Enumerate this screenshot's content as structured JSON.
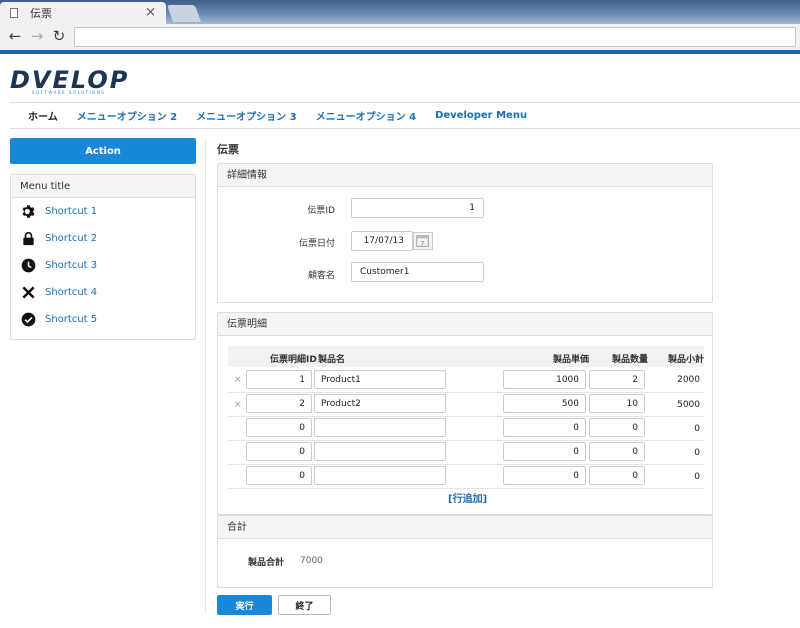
{
  "browser": {
    "tab_title": "伝票",
    "tab_close": "×",
    "nav_back": "←",
    "nav_forward": "→",
    "nav_reload": "↻"
  },
  "brand": {
    "logo_text": "DVELOP",
    "logo_sub": "SOFTWARE SOLUTIONS"
  },
  "nav": {
    "items": [
      "ホーム",
      "メニューオプション 2",
      "メニューオプション 3",
      "メニューオプション 4",
      "Developer Menu"
    ]
  },
  "sidebar": {
    "action_label": "Action",
    "menu_title": "Menu title",
    "shortcuts": [
      {
        "label": "Shortcut 1",
        "icon": "gear-icon"
      },
      {
        "label": "Shortcut 2",
        "icon": "lock-icon"
      },
      {
        "label": "Shortcut 3",
        "icon": "clock-icon"
      },
      {
        "label": "Shortcut 4",
        "icon": "close-icon"
      },
      {
        "label": "Shortcut 5",
        "icon": "check-circle-icon"
      }
    ]
  },
  "main": {
    "page_title": "伝票",
    "detail": {
      "heading": "詳細情報",
      "id_label": "伝票ID",
      "id_value": "1",
      "date_label": "伝票日付",
      "date_value": "17/07/13",
      "customer_label": "顧客名",
      "customer_value": "Customer1"
    },
    "lines": {
      "heading": "伝票明細",
      "columns": {
        "line_id": "伝票明細ID",
        "product": "製品名",
        "unit_price": "製品単価",
        "qty": "製品数量",
        "subtotal": "製品小計"
      },
      "delete_mark": "×",
      "rows": [
        {
          "line_id": "1",
          "product": "Product1",
          "unit_price": "1000",
          "qty": "2",
          "subtotal": "2000"
        },
        {
          "line_id": "2",
          "product": "Product2",
          "unit_price": "500",
          "qty": "10",
          "subtotal": "5000"
        },
        {
          "line_id": "0",
          "product": "",
          "unit_price": "0",
          "qty": "0",
          "subtotal": "0"
        },
        {
          "line_id": "0",
          "product": "",
          "unit_price": "0",
          "qty": "0",
          "subtotal": "0"
        },
        {
          "line_id": "0",
          "product": "",
          "unit_price": "0",
          "qty": "0",
          "subtotal": "0"
        }
      ],
      "add_row": "[行追加]"
    },
    "total": {
      "heading": "合計",
      "label": "製品合計",
      "value": "7000"
    },
    "buttons": {
      "run": "実行",
      "end": "終了"
    }
  },
  "colors": {
    "accent": "#1a88d8",
    "link": "#1a6eb5",
    "brand_dark": "#1b3553"
  }
}
